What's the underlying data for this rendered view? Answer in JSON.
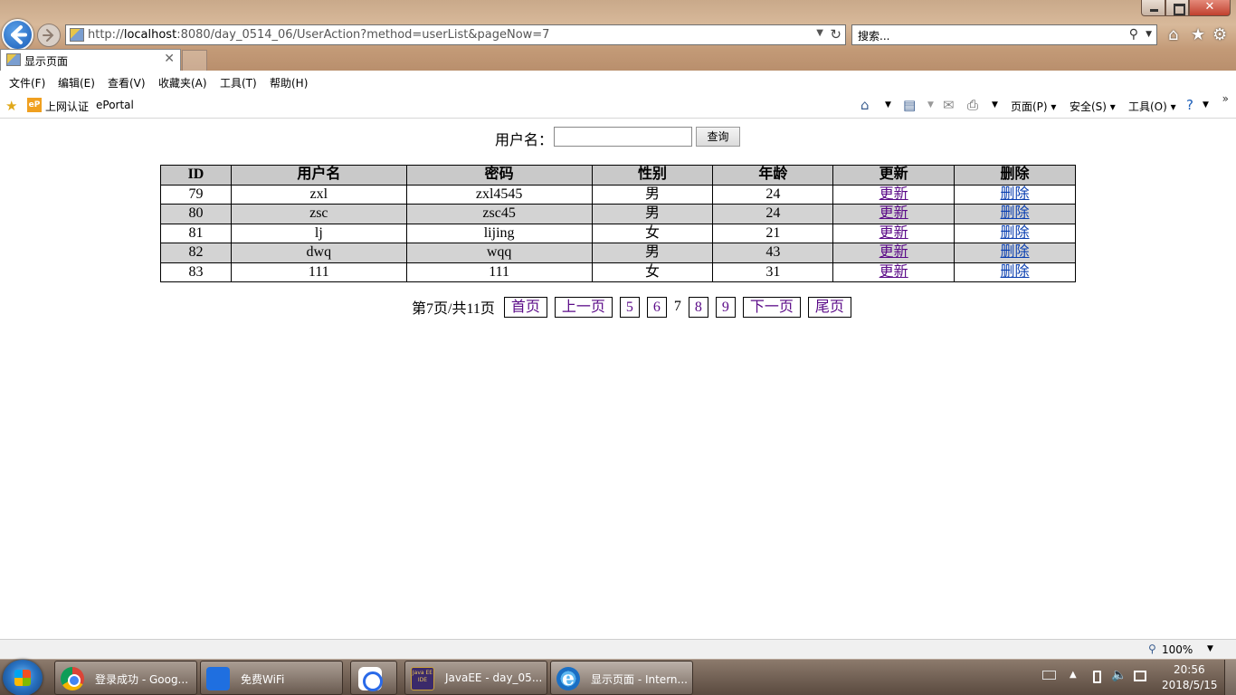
{
  "browser": {
    "url_prefix": "http://",
    "url_host": "localhost",
    "url_rest": ":8080/day_0514_06/UserAction?method=userList&pageNow=7",
    "search_placeholder": "搜索...",
    "tab_title": "显示页面",
    "menu": [
      "文件(F)",
      "编辑(E)",
      "查看(V)",
      "收藏夹(A)",
      "工具(T)",
      "帮助(H)"
    ],
    "favorites": [
      "上网认证",
      "ePortal"
    ],
    "eportal_icon_text": "eP",
    "commands": {
      "page": "页面(P)",
      "safety": "安全(S)",
      "tools": "工具(O)"
    },
    "zoom": "100%"
  },
  "form": {
    "label": "用户名：",
    "input_value": "",
    "button_label": "查询"
  },
  "table": {
    "headers": [
      "ID",
      "用户名",
      "密码",
      "性别",
      "年龄",
      "更新",
      "删除"
    ],
    "rows": [
      {
        "id": "79",
        "name": "zxl",
        "pwd": "zxl4545",
        "sex": "男",
        "age": "24",
        "update": "更新",
        "delete": "删除"
      },
      {
        "id": "80",
        "name": "zsc",
        "pwd": "zsc45",
        "sex": "男",
        "age": "24",
        "update": "更新",
        "delete": "删除"
      },
      {
        "id": "81",
        "name": "lj",
        "pwd": "lijing",
        "sex": "女",
        "age": "21",
        "update": "更新",
        "delete": "删除"
      },
      {
        "id": "82",
        "name": "dwq",
        "pwd": "wqq",
        "sex": "男",
        "age": "43",
        "update": "更新",
        "delete": "删除"
      },
      {
        "id": "83",
        "name": "111",
        "pwd": "111",
        "sex": "女",
        "age": "31",
        "update": "更新",
        "delete": "删除"
      }
    ]
  },
  "pager": {
    "status": "第7页/共11页",
    "first": "首页",
    "prev": "上一页",
    "pages_before": [
      "5",
      "6"
    ],
    "current": "7",
    "pages_after": [
      "8",
      "9"
    ],
    "next": "下一页",
    "last": "尾页"
  },
  "taskbar": {
    "tasks": [
      "登录成功 - Goog...",
      "免费WiFi",
      "",
      "JavaEE - day_05...",
      "显示页面 - Intern..."
    ],
    "java_icon_text": "Java EE IDE",
    "time": "20:56",
    "date": "2018/5/15"
  },
  "colors": {
    "visited_link": "#5b0b88",
    "link": "#0a3fb0",
    "header_bg": "#c9c9c9",
    "alt_row_bg": "#d3d3d3"
  }
}
